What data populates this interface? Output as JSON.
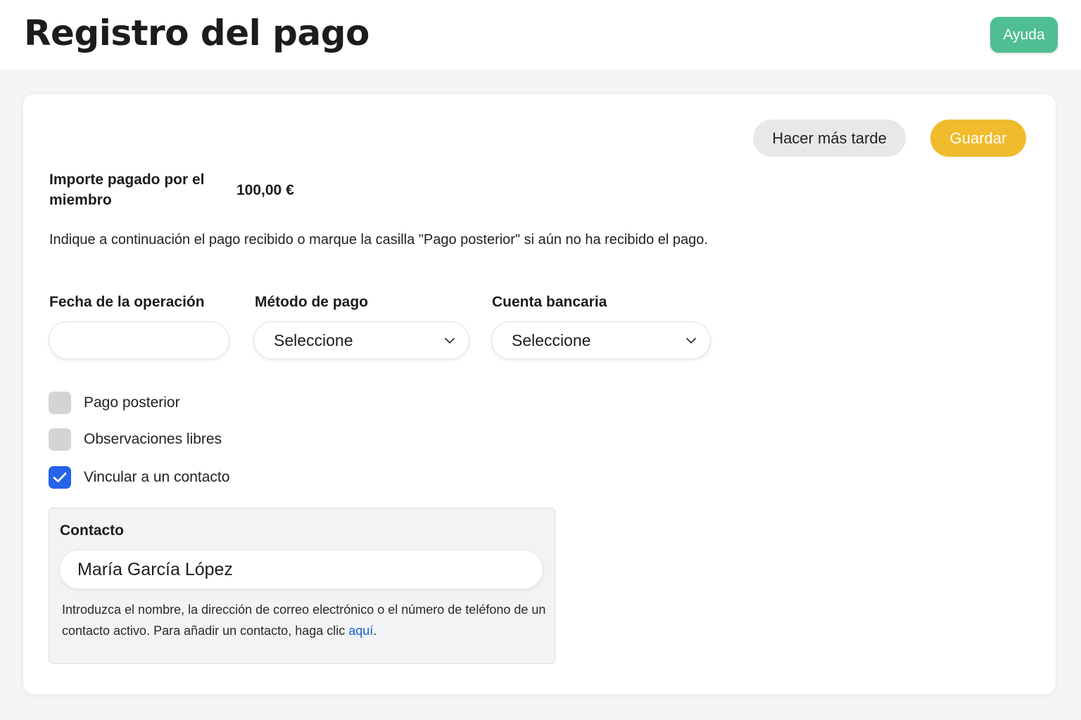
{
  "header": {
    "title": "Registro del pago",
    "help_label": "Ayuda"
  },
  "actions": {
    "later_label": "Hacer más tarde",
    "save_label": "Guardar"
  },
  "amount": {
    "label": "Importe pagado por el miembro",
    "value": "100,00 €"
  },
  "instructions": "Indique a continuación el pago recibido o marque la casilla \"Pago posterior\" si aún no ha recibido el pago.",
  "fields": {
    "date": {
      "label": "Fecha de la operación",
      "value": ""
    },
    "method": {
      "label": "Método de pago",
      "selected": "Seleccione"
    },
    "account": {
      "label": "Cuenta bancaria",
      "selected": "Seleccione"
    }
  },
  "checkboxes": [
    {
      "label": "Pago posterior",
      "checked": false
    },
    {
      "label": "Observaciones libres",
      "checked": false
    },
    {
      "label": "Vincular a un contacto",
      "checked": true
    }
  ],
  "contact": {
    "title": "Contacto",
    "value": "María García López",
    "help_prefix": "Introduzca el nombre, la dirección de correo electrónico o el número de teléfono de un contacto activo. Para añadir un contacto, haga clic ",
    "help_link": "aquí",
    "help_suffix": "."
  },
  "colors": {
    "help_button": "#4fbe92",
    "save_button": "#f0bb2d",
    "checkbox_checked": "#2563eb",
    "link": "#1d5fd6"
  },
  "icons": {
    "dropdown": "chevron-down-icon",
    "checked": "checkmark-icon"
  }
}
